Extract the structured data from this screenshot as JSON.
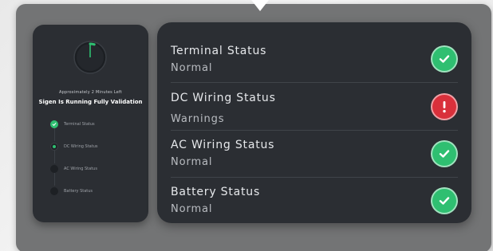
{
  "progress_panel": {
    "caption": "Approximately 2 Minutes Left",
    "title": "Sigen Is Running Fully Validation",
    "progress_fraction": 0.05,
    "steps": [
      {
        "label": "Terminal Status",
        "state": "done"
      },
      {
        "label": "DC Wiring Status",
        "state": "active"
      },
      {
        "label": "AC Wiring Status",
        "state": "pending"
      },
      {
        "label": "Battery Status",
        "state": "pending"
      }
    ]
  },
  "status_panel": {
    "items": [
      {
        "title": "Terminal Status",
        "value": "Normal",
        "icon": "check-icon",
        "color": "#2fbf71"
      },
      {
        "title": "DC Wiring Status",
        "value": "Warnings",
        "icon": "exclamation-icon",
        "color": "#d9303b"
      },
      {
        "title": "AC Wiring Status",
        "value": "Normal",
        "icon": "check-icon",
        "color": "#2fbf71"
      },
      {
        "title": "Battery Status",
        "value": "Normal",
        "icon": "check-icon",
        "color": "#2fbf71"
      }
    ]
  },
  "colors": {
    "panel_bg": "#2b2e33",
    "outer_bg": "#737475",
    "ok": "#2fbf71",
    "warn": "#d9303b"
  }
}
